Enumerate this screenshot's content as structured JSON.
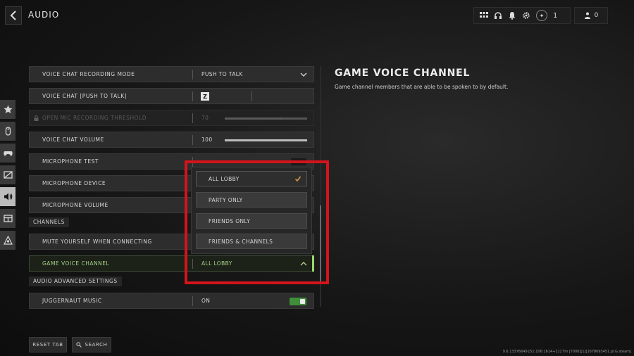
{
  "header": {
    "title": "AUDIO",
    "level": "1",
    "party_count": "0"
  },
  "settings": {
    "voice_chat_recording_mode": {
      "label": "VOICE CHAT RECORDING MODE",
      "value": "PUSH TO TALK"
    },
    "voice_chat_ptt": {
      "label": "VOICE CHAT [PUSH TO TALK]",
      "key": "Z"
    },
    "open_mic_threshold": {
      "label": "OPEN MIC RECORDING THRESHOLD",
      "value": "70",
      "level": 0.7
    },
    "voice_chat_volume": {
      "label": "VOICE CHAT VOLUME",
      "value": "100",
      "level": 1.0
    },
    "microphone_test": {
      "label": "MICROPHONE TEST"
    },
    "microphone_device": {
      "label": "MICROPHONE DEVICE"
    },
    "microphone_volume": {
      "label": "MICROPHONE VOLUME"
    },
    "channels_header": "CHANNELS",
    "mute_on_connect": {
      "label": "MUTE YOURSELF WHEN CONNECTING"
    },
    "game_voice_channel": {
      "label": "GAME VOICE CHANNEL",
      "value": "ALL LOBBY"
    },
    "advanced_header": "AUDIO ADVANCED SETTINGS",
    "juggernaut_music": {
      "label": "JUGGERNAUT MUSIC",
      "value": "ON",
      "enabled": true
    }
  },
  "dropdown": {
    "options": [
      "ALL LOBBY",
      "PARTY ONLY",
      "FRIENDS ONLY",
      "FRIENDS & CHANNELS"
    ],
    "selected": "ALL LOBBY"
  },
  "info_panel": {
    "title": "GAME VOICE CHANNEL",
    "description": "Game channel members that are able to be spoken to by default."
  },
  "footer": {
    "reset_label": "RESET TAB",
    "search_label": "SEARCH",
    "build_info": "9.6.13376649 [51:106:1614+11] Tm [7000][1][1678693451.pl.G.steam]"
  },
  "colors": {
    "accent_green": "#9ed86a",
    "highlight_red": "#d3141b",
    "toggle_green": "#3f8f3a"
  }
}
